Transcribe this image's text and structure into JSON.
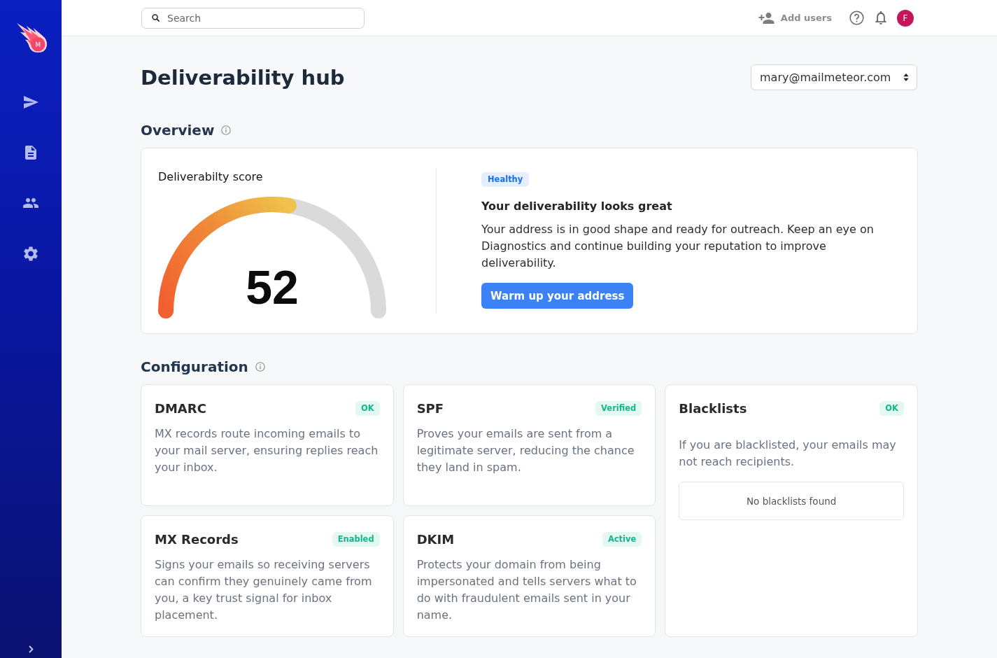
{
  "sidebar": {
    "logo_letter": "M"
  },
  "top_bar": {
    "search": {
      "placeholder": "Search"
    },
    "add_users": "Add users",
    "avatar_initial": "F"
  },
  "header": {
    "title": "Deliverability hub",
    "account_select": {
      "value": "mary@mailmeteor.com"
    }
  },
  "overview": {
    "heading": "Overview",
    "score": {
      "label": "Deliverabilty score",
      "value": "52",
      "level": 0.55
    },
    "status_badge": "Healthy",
    "headline": "Your deliverability looks great",
    "text": "Your address is in good shape and ready for outreach. Keep an eye on Diagnostics and continue building your reputation to improve deliverability.",
    "button": "Warm up your address"
  },
  "configuration": {
    "heading": "Configuration",
    "cards": [
      {
        "kind": "check",
        "title": "DMARC",
        "badge": "OK",
        "description": "MX records route incoming emails to your mail server, ensuring replies reach your inbox."
      },
      {
        "kind": "check",
        "title": "SPF",
        "badge": "Verified",
        "description": "Proves your emails are sent from a legitimate server, reducing the chance they land in spam."
      },
      {
        "kind": "blacklist",
        "title": "Blacklists",
        "badge": "OK",
        "description": "If you are blacklisted, your emails may not reach recipients.",
        "result": "No blacklists found"
      },
      {
        "kind": "check",
        "title": "MX Records",
        "badge": "Enabled",
        "description": "Signs your emails so receiving servers can confirm they genuinely came from you, a key trust signal for inbox placement."
      },
      {
        "kind": "check",
        "title": "DKIM",
        "badge": "Active",
        "description": "Protects your domain from being impersonated and tells servers what to do with fraudulent emails sent in your name."
      }
    ]
  }
}
